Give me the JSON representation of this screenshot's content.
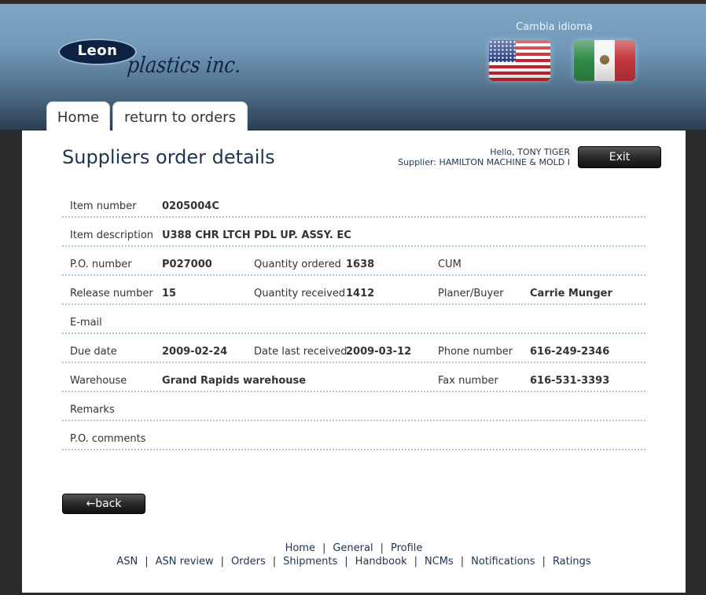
{
  "header": {
    "language_label": "Cambia idioma",
    "logo_text": "Leon",
    "logo_script": "plastics inc.",
    "flags": [
      "us-flag-icon",
      "mexico-flag-icon"
    ]
  },
  "tabs": [
    {
      "label": "Home"
    },
    {
      "label": "return to orders"
    }
  ],
  "page": {
    "title": "Suppliers order details",
    "greeting": "Hello, TONY TIGER",
    "supplier": "Supplier: HAMILTON MACHINE & MOLD I",
    "exit_label": "Exit",
    "back_label": "←back"
  },
  "details": {
    "item_number_label": "Item number",
    "item_number": "0205004C",
    "item_description_label": "Item description",
    "item_description": "U388 CHR LTCH PDL UP. ASSY. EC",
    "po_number_label": "P.O. number",
    "po_number": "P027000",
    "qty_ordered_label": "Quantity ordered",
    "qty_ordered": "1638",
    "cum_label": "CUM",
    "release_number_label": "Release number",
    "release_number": "15",
    "qty_received_label": "Quantity received",
    "qty_received": "1412",
    "planner_label": "Planer/Buyer",
    "planner": "Carrie Munger",
    "email_label": "E-mail",
    "due_date_label": "Due date",
    "due_date": "2009-02-24",
    "date_last_received_label": "Date last received",
    "date_last_received": "2009-03-12",
    "phone_label": "Phone number",
    "phone": "616-249-2346",
    "warehouse_label": "Warehouse",
    "warehouse": "Grand Rapids warehouse",
    "fax_label": "Fax number",
    "fax": "616-531-3393",
    "remarks_label": "Remarks",
    "po_comments_label": "P.O. comments"
  },
  "footer": {
    "row1": [
      "Home",
      "General",
      "Profile"
    ],
    "row2": [
      "ASN",
      "ASN review",
      "Orders",
      "Shipments",
      "Handbook",
      "NCMs",
      "Notifications",
      "Ratings"
    ]
  },
  "colors": {
    "header_top": "#7fa7c5",
    "header_bottom": "#2c3f52",
    "title": "#1d3550",
    "divider": "#a9c5dd",
    "button": "#2a2a2a"
  }
}
